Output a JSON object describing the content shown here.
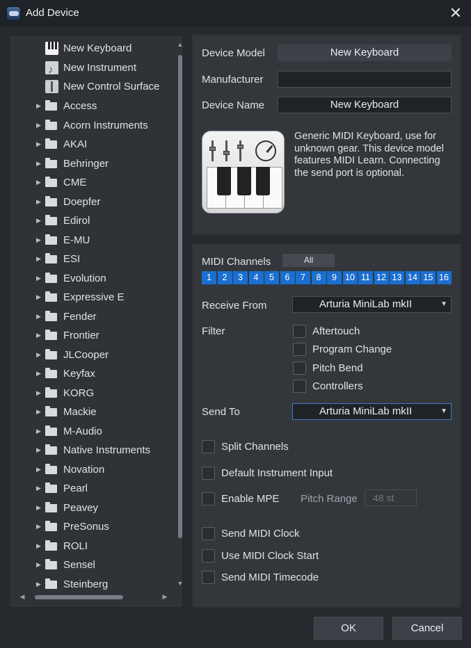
{
  "window": {
    "title": "Add Device",
    "close_icon": "close-icon"
  },
  "tree": {
    "devices": [
      {
        "label": "New Keyboard",
        "icon": "keyboard-icon"
      },
      {
        "label": "New Instrument",
        "icon": "instrument-icon"
      },
      {
        "label": "New Control Surface",
        "icon": "control-surface-icon"
      }
    ],
    "folders": [
      "Access",
      "Acorn Instruments",
      "AKAI",
      "Behringer",
      "CME",
      "Doepfer",
      "Edirol",
      "E-MU",
      "ESI",
      "Evolution",
      "Expressive E",
      "Fender",
      "Frontier",
      "JLCooper",
      "Keyfax",
      "KORG",
      "Mackie",
      "M-Audio",
      "Native Instruments",
      "Novation",
      "Pearl",
      "Peavey",
      "PreSonus",
      "ROLI",
      "Sensel",
      "Steinberg"
    ]
  },
  "device": {
    "model_label": "Device Model",
    "model_value": "New Keyboard",
    "manufacturer_label": "Manufacturer",
    "manufacturer_value": "",
    "name_label": "Device Name",
    "name_value": "New Keyboard",
    "description": "Generic MIDI Keyboard, use for unknown gear. This device model features MIDI Learn. Connecting the send port is optional."
  },
  "midi": {
    "channels_label": "MIDI Channels",
    "all_label": "All",
    "channels": [
      "1",
      "2",
      "3",
      "4",
      "5",
      "6",
      "7",
      "8",
      "9",
      "10",
      "11",
      "12",
      "13",
      "14",
      "15",
      "16"
    ],
    "channel_color": "#1a6fd1",
    "receive_label": "Receive From",
    "receive_value": "Arturia MiniLab mkII",
    "filter_label": "Filter",
    "filters": [
      "Aftertouch",
      "Program Change",
      "Pitch Bend",
      "Controllers"
    ],
    "send_label": "Send To",
    "send_value": "Arturia MiniLab mkII",
    "options": {
      "split_channels": "Split Channels",
      "default_instrument_input": "Default Instrument Input",
      "enable_mpe": "Enable MPE",
      "pitch_range_label": "Pitch Range",
      "pitch_range_value": "48 st",
      "send_midi_clock": "Send MIDI Clock",
      "use_midi_clock_start": "Use MIDI Clock Start",
      "send_midi_timecode": "Send MIDI Timecode"
    }
  },
  "buttons": {
    "ok": "OK",
    "cancel": "Cancel"
  }
}
